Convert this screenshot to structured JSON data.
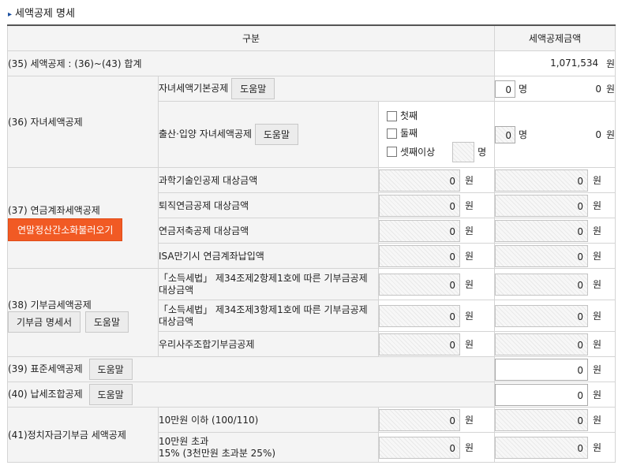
{
  "section_title": "세액공제 명세",
  "header": {
    "col1": "구분",
    "col2": "세액공제금액"
  },
  "unit_won": "원",
  "unit_person": "명",
  "row35": {
    "label": "(35) 세액공제 : (36)~(43) 합계",
    "amount": "1,071,534"
  },
  "row36": {
    "label": "(36) 자녀세액공제",
    "basic": {
      "label": "자녀세액기본공제",
      "help": "도움말",
      "count": "0",
      "amount": "0"
    },
    "birth": {
      "label": "출산·입양 자녀세액공제",
      "help": "도움말",
      "options": [
        "첫째",
        "둘째",
        "셋째이상"
      ],
      "count": "0",
      "amount": "0"
    }
  },
  "row37": {
    "label": "(37) 연금계좌세액공제",
    "button": "연말정산간소화불러오기",
    "items": [
      {
        "label": "과학기술인공제 대상금액",
        "amount": "0",
        "credit": "0"
      },
      {
        "label": "퇴직연금공제 대상금액",
        "amount": "0",
        "credit": "0"
      },
      {
        "label": "연금저축공제 대상금액",
        "amount": "0",
        "credit": "0"
      },
      {
        "label": "ISA만기시 연금계좌납입액",
        "amount": "0",
        "credit": "0"
      }
    ]
  },
  "row38": {
    "label": "(38) 기부금세액공제",
    "detail_button": "기부금 명세서",
    "help": "도움말",
    "items": [
      {
        "label": "「소득세법」 제34조제2항제1호에 따른 기부금공제 대상금액",
        "amount": "0",
        "credit": "0"
      },
      {
        "label": "「소득세법」 제34조제3항제1호에 따른 기부금공제 대상금액",
        "amount": "0",
        "credit": "0"
      },
      {
        "label": "우리사주조합기부금공제",
        "amount": "0",
        "credit": "0"
      }
    ]
  },
  "row39": {
    "label": "(39) 표준세액공제",
    "help": "도움말",
    "amount": "0"
  },
  "row40": {
    "label": "(40) 납세조합공제",
    "help": "도움말",
    "amount": "0"
  },
  "row41": {
    "label": "(41)정치자금기부금 세액공제",
    "items": [
      {
        "line1": "10만원 이하 (100/110)",
        "line2": "",
        "amount": "0",
        "credit": "0"
      },
      {
        "line1": "10만원 초과",
        "line2": "15% (3천만원 초과분 25%)",
        "amount": "0",
        "credit": "0"
      }
    ]
  }
}
